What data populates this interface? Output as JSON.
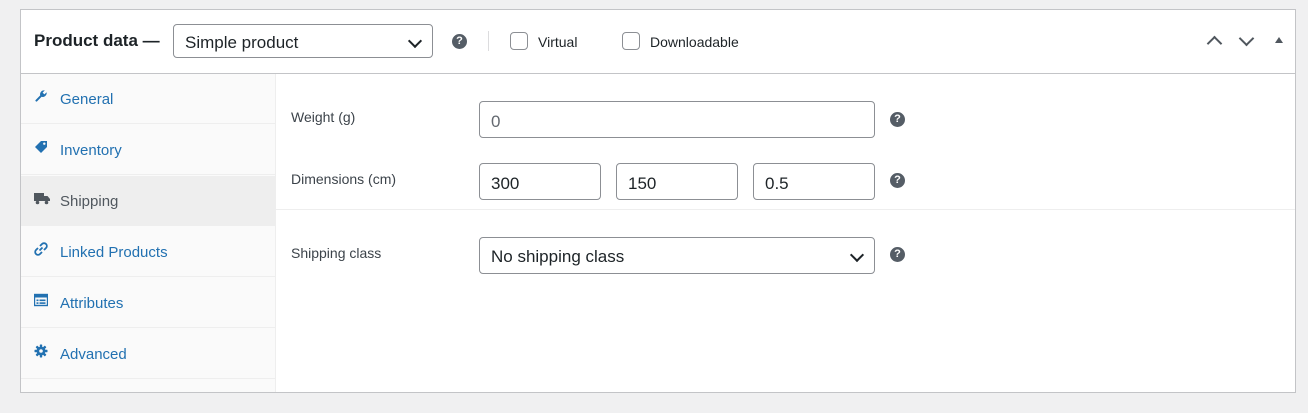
{
  "header": {
    "title": "Product data —",
    "product_type": "Simple product",
    "virtual_label": "Virtual",
    "downloadable_label": "Downloadable",
    "help_glyph": "?"
  },
  "tabs": [
    {
      "label": "General",
      "icon": "wrench-icon",
      "active": false
    },
    {
      "label": "Inventory",
      "icon": "tag-icon",
      "active": false
    },
    {
      "label": "Shipping",
      "icon": "truck-icon",
      "active": true
    },
    {
      "label": "Linked Products",
      "icon": "link-icon",
      "active": false
    },
    {
      "label": "Attributes",
      "icon": "list-icon",
      "active": false
    },
    {
      "label": "Advanced",
      "icon": "gear-icon",
      "active": false
    }
  ],
  "shipping": {
    "weight_label": "Weight (g)",
    "weight_placeholder": "0",
    "dimensions_label": "Dimensions (cm)",
    "length": "300",
    "width": "150",
    "height": "0.5",
    "class_label": "Shipping class",
    "class_value": "No shipping class"
  },
  "colors": {
    "link": "#2271b1",
    "border": "#c3c4c7",
    "tabs_bg": "#fafafa",
    "active_tab_bg": "#eeeeee",
    "page_bg": "#f0f0f1"
  }
}
